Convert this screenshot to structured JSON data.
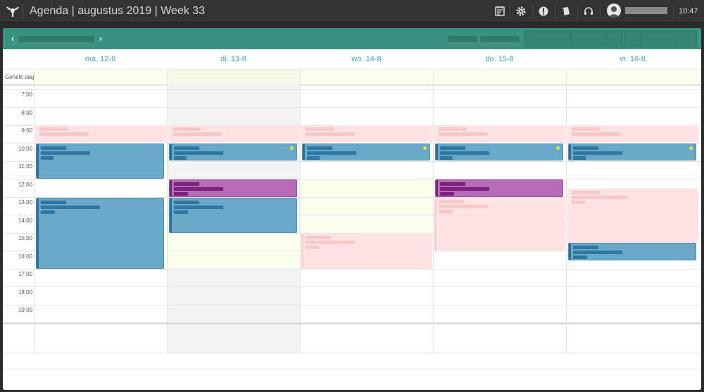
{
  "window": {
    "title": "Agenda | augustus 2019 | Week 33",
    "clock": "10:47"
  },
  "icons": {
    "logo": "app-logo-icon",
    "toolbar": [
      "notes-icon",
      "gear-icon",
      "info-icon",
      "book-icon",
      "headset-icon"
    ],
    "user": "avatar-icon"
  },
  "calendar": {
    "days": [
      "ma. 12-8",
      "di. 13-8",
      "wo. 14-8",
      "do. 15-8",
      "vr. 16-8"
    ],
    "allday_label": "Gehele dag",
    "hours": [
      "7:00",
      "8:00",
      "9:00",
      "10:00",
      "11:00",
      "12:00",
      "13:00",
      "14:00",
      "15:00",
      "16:00",
      "17:00",
      "18:00",
      "19:00"
    ]
  },
  "colors": {
    "toolbar": "#3c9280",
    "day_header_text": "#40a3cf",
    "event_blue": "#6aa8c7",
    "event_purple": "#b56bb5",
    "event_pink": "#fde3e3",
    "allday_bg": "#fdfdee"
  }
}
